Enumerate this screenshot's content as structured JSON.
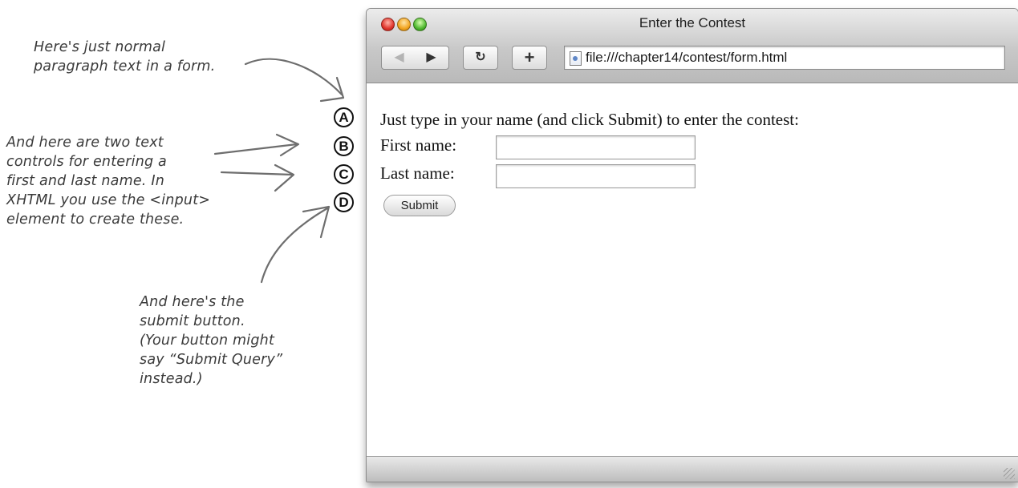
{
  "annotations": {
    "paragraph_note": "Here's just normal\nparagraph text in a form.",
    "controls_note": "And here are two text\ncontrols for entering a\nfirst and last name. In\nXHTML you use the <input>\nelement to create these.",
    "submit_note": "And here's the\nsubmit button.\n(Your button might\nsay “Submit Query”\ninstead.)"
  },
  "markers": [
    "A",
    "B",
    "C",
    "D"
  ],
  "window": {
    "title": "Enter the Contest",
    "url": "file:///chapter14/contest/form.html"
  },
  "toolbar": {
    "back_icon": "◀",
    "forward_icon": "▶",
    "reload_icon": "↻",
    "add_icon": "+"
  },
  "form": {
    "intro_text": "Just type in your name (and click Submit) to enter the contest:",
    "first_name_label": "First name:",
    "first_name_value": "",
    "last_name_label": "Last name:",
    "last_name_value": "",
    "submit_label": "Submit"
  }
}
